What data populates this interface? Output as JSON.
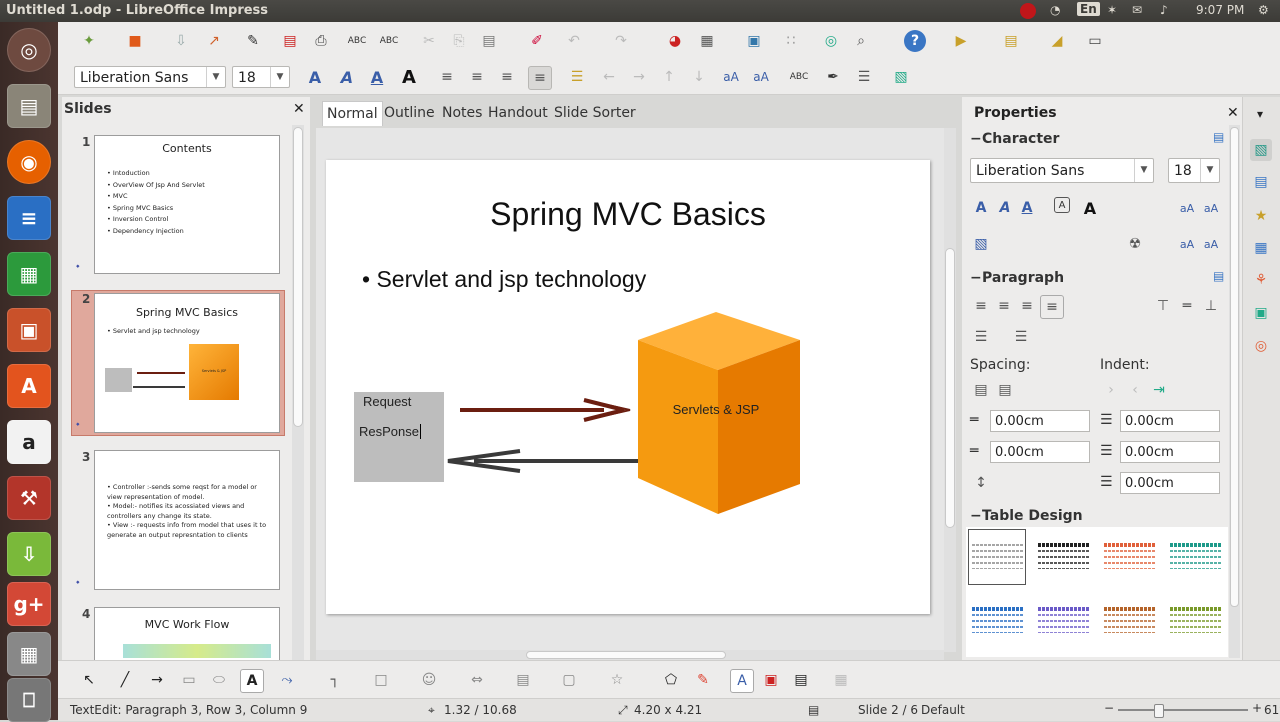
{
  "window": {
    "title": "Untitled 1.odp - LibreOffice Impress"
  },
  "tray": {
    "keyboard": "En",
    "time": "9:07 PM"
  },
  "format": {
    "font_name": "Liberation Sans",
    "font_size": "18"
  },
  "slides_panel": {
    "title": "Slides",
    "slides": [
      {
        "num": "1",
        "title": "Contents",
        "bullets": [
          "• Intoduction",
          "• OverView Of Jsp And Servlet",
          "• MVC",
          "• Spring MVC Basics",
          "• Inversion Control",
          "• Dependency Injection"
        ]
      },
      {
        "num": "2",
        "title": "Spring MVC Basics",
        "bullets": [
          "• Servlet and jsp technology"
        ],
        "cube_label": "Servlets & JSP"
      },
      {
        "num": "3",
        "title": "",
        "bullets": [
          "• Controller :-sends some reqst for a model or",
          "   view representation of model.",
          "• Model:- notifies its acossiated views and",
          "   controllers any change its state.",
          "• View :- requests info from model that uses it to",
          "   generate an output represntation to clients"
        ]
      },
      {
        "num": "4",
        "title": "MVC Work Flow",
        "bullets": []
      }
    ]
  },
  "view_tabs": [
    "Normal",
    "Outline",
    "Notes",
    "Handout",
    "Slide Sorter"
  ],
  "slide": {
    "title": "Spring MVC Basics",
    "bullet": "• Servlet and jsp technology",
    "box_line1": "Request",
    "box_line2": "ResPonse",
    "cube_label": "Servlets & JSP",
    "colors": {
      "cube": "#f28c00",
      "arrow_request": "#6b1e10",
      "arrow_response": "#3a3a3a",
      "box": "#bdbdbd"
    }
  },
  "properties": {
    "title": "Properties",
    "character": {
      "title": "Character",
      "font": "Liberation Sans",
      "size": "18"
    },
    "paragraph": {
      "title": "Paragraph",
      "spacing_label": "Spacing:",
      "indent_label": "Indent:",
      "spacing_above": "0.00cm",
      "spacing_below": "0.00cm",
      "indent_before": "0.00cm",
      "indent_after": "0.00cm",
      "indent_first": "0.00cm"
    },
    "table_design": {
      "title": "Table Design"
    }
  },
  "status": {
    "edit_info": "TextEdit: Paragraph 3, Row 3, Column 9",
    "position": "1.32 / 10.68",
    "size": "4.20 x 4.21",
    "slide_info": "Slide 2 / 6",
    "layout": "Default",
    "zoom": "61%"
  }
}
